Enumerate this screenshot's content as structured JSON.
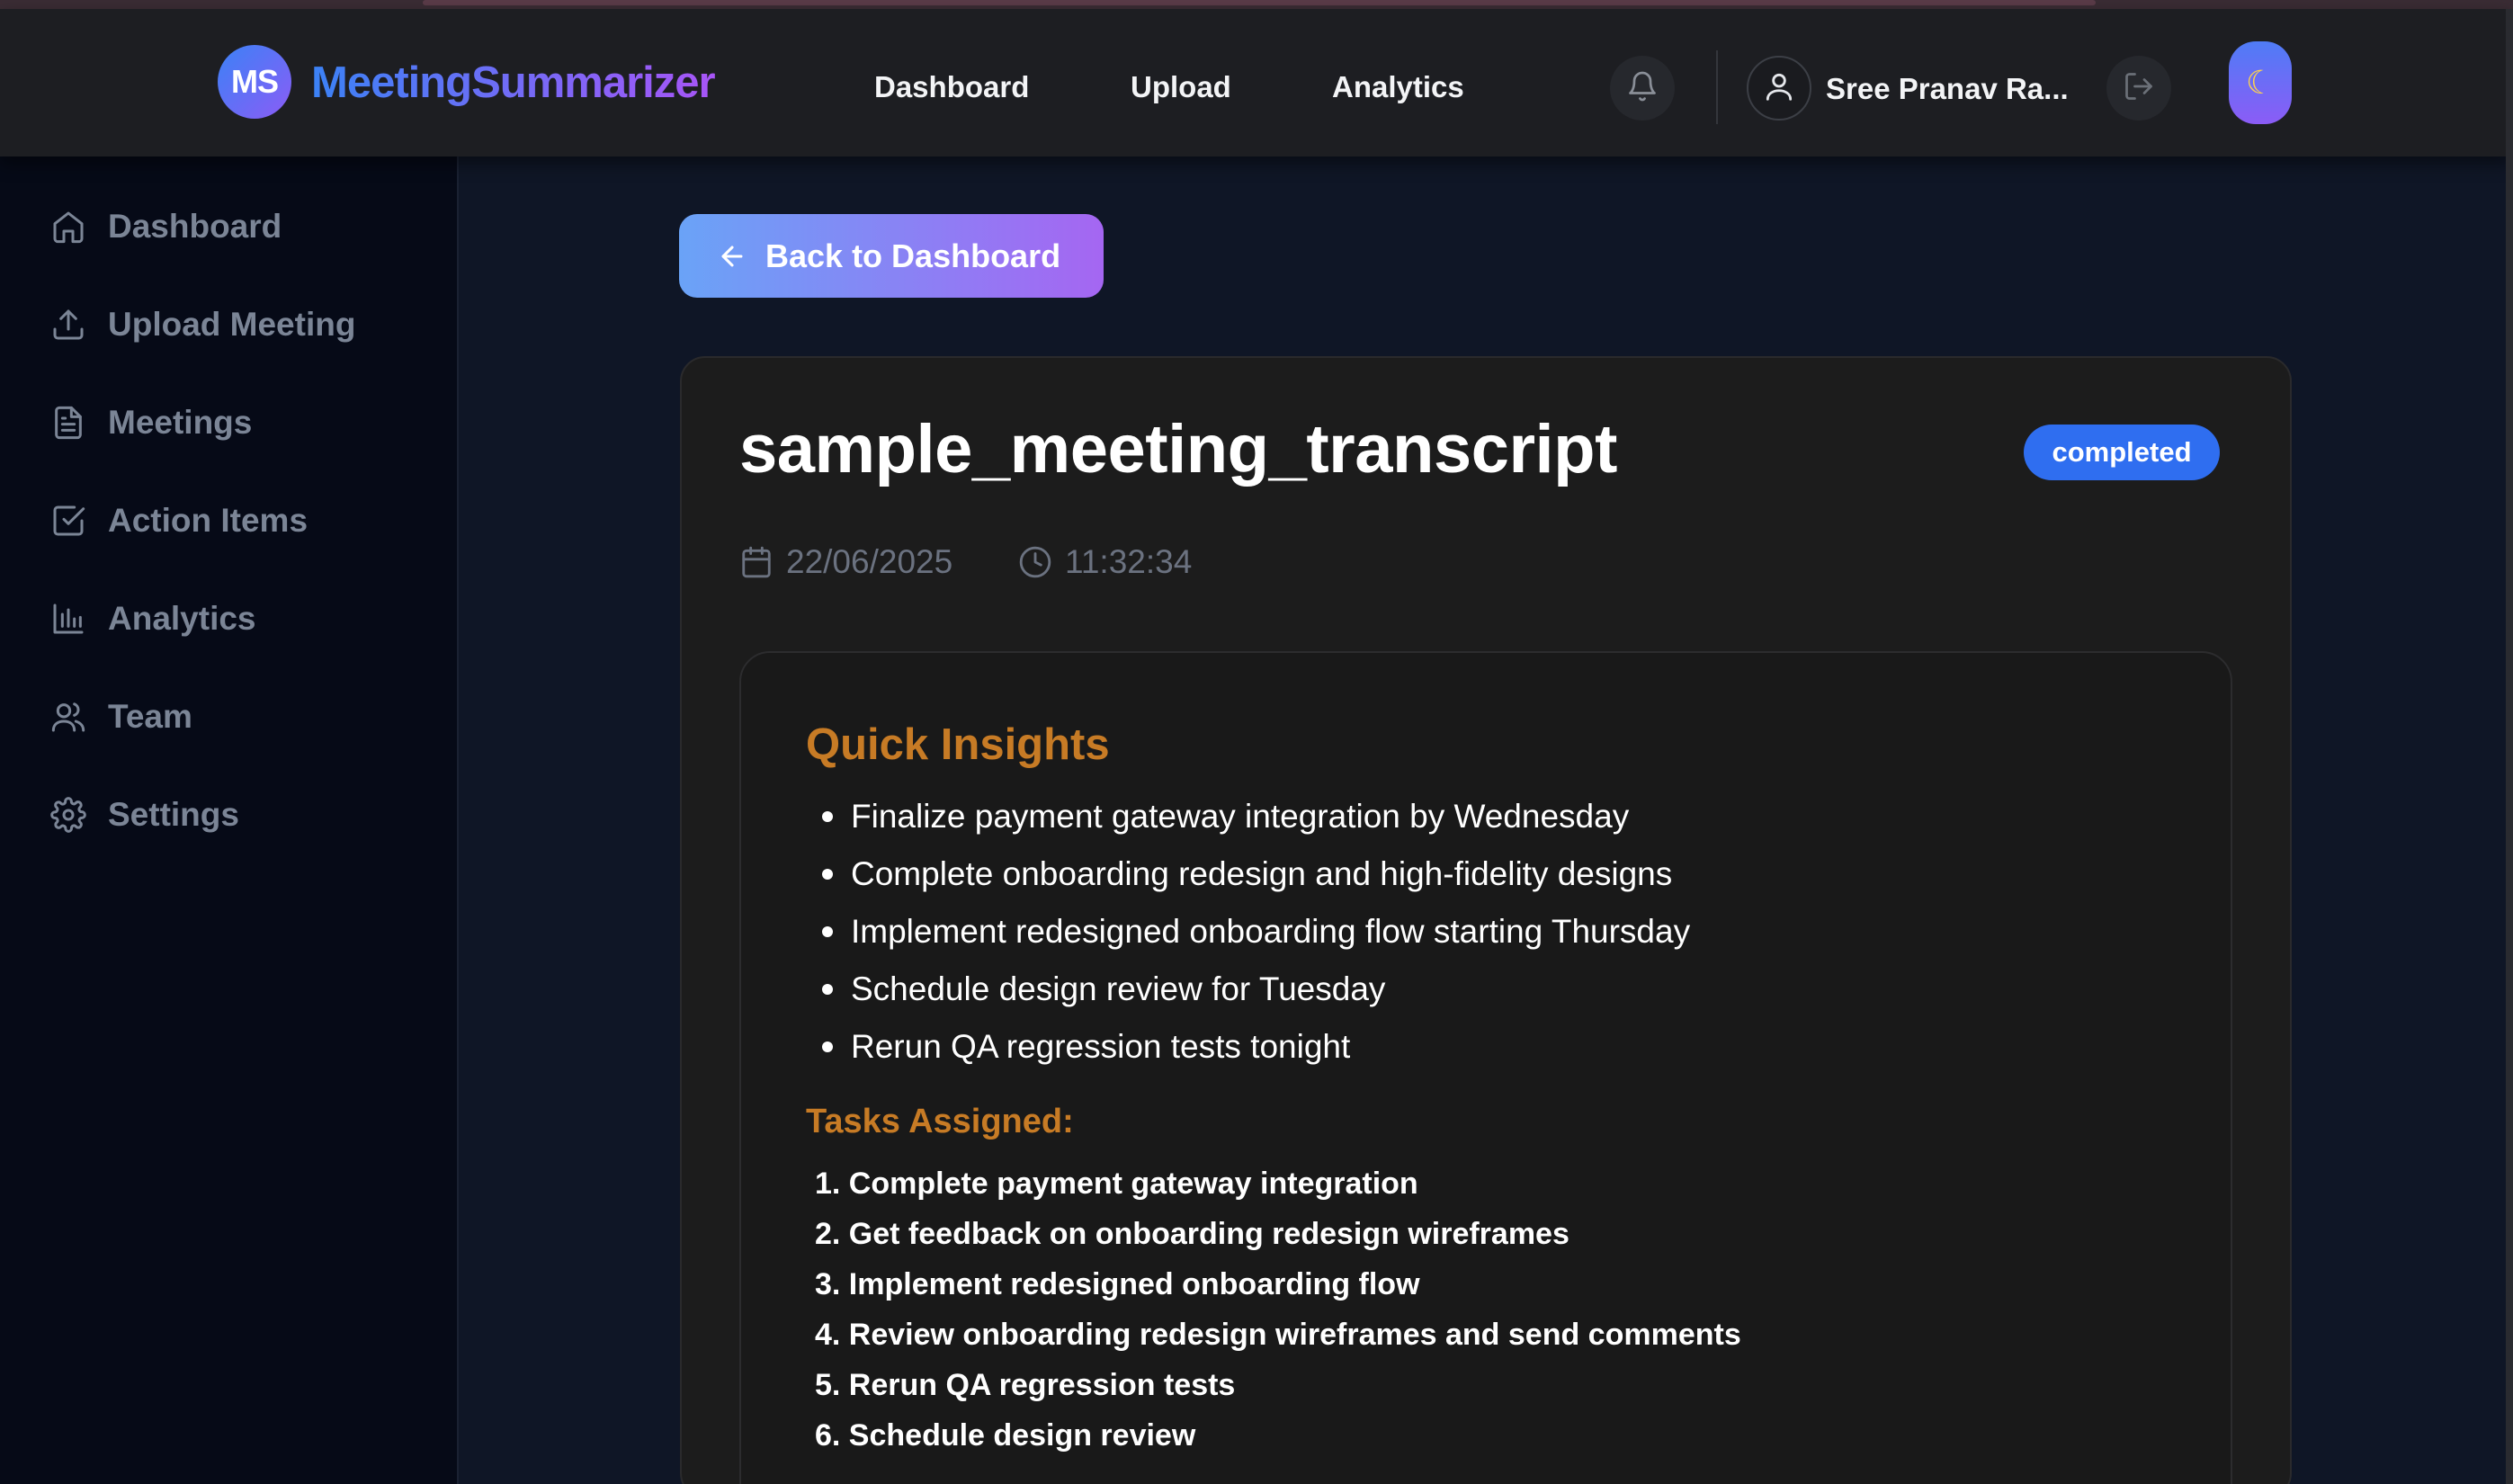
{
  "header": {
    "logo_initials": "MS",
    "brand": "MeetingSummarizer",
    "nav": [
      "Dashboard",
      "Upload",
      "Analytics"
    ],
    "user_name": "Sree Pranav Ra...",
    "icons": {
      "bell": "bell-icon",
      "user": "user-icon",
      "logout": "logout-icon",
      "theme": "moon-icon"
    }
  },
  "sidebar": {
    "items": [
      {
        "label": "Dashboard",
        "icon": "home-icon"
      },
      {
        "label": "Upload Meeting",
        "icon": "upload-icon"
      },
      {
        "label": "Meetings",
        "icon": "document-icon"
      },
      {
        "label": "Action Items",
        "icon": "checkbox-icon"
      },
      {
        "label": "Analytics",
        "icon": "bar-chart-icon"
      },
      {
        "label": "Team",
        "icon": "users-icon"
      },
      {
        "label": "Settings",
        "icon": "gear-icon"
      }
    ]
  },
  "main": {
    "back_label": "Back to Dashboard",
    "meeting": {
      "title": "sample_meeting_transcript",
      "status": "completed",
      "date": "22/06/2025",
      "time": "11:32:34"
    },
    "insights": {
      "title": "Quick Insights",
      "bullets": [
        "Finalize payment gateway integration by Wednesday",
        "Complete onboarding redesign and high-fidelity designs",
        "Implement redesigned onboarding flow starting Thursday",
        "Schedule design review for Tuesday",
        "Rerun QA regression tests tonight"
      ],
      "tasks_title": "Tasks Assigned:",
      "tasks": [
        "1. Complete payment gateway integration",
        "2. Get feedback on onboarding redesign wireframes",
        "3. Implement redesigned onboarding flow",
        "4. Review onboarding redesign wireframes and send comments",
        "5. Rerun QA regression tests",
        "6. Schedule design review"
      ]
    }
  },
  "colors": {
    "accent_blue": "#3b82f6",
    "accent_purple": "#8b5cf6",
    "section_orange": "#c77b25",
    "status_badge": "#2f6ef0"
  }
}
